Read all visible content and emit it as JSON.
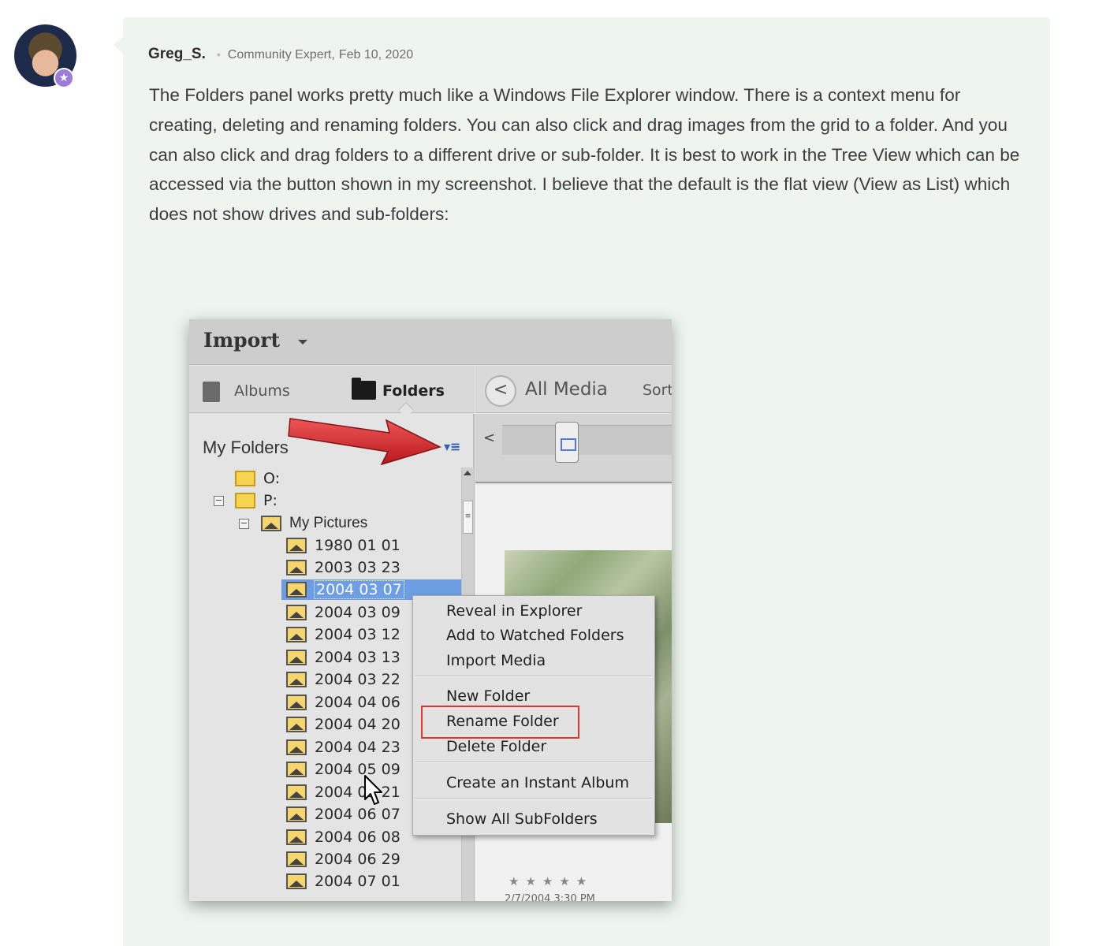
{
  "post": {
    "author": "Greg_S.",
    "separator": "•",
    "role": "Community Expert,",
    "date": "Feb 10, 2020",
    "body": "The Folders panel works pretty much like a Windows File Explorer window.  There is a context menu for creating, deleting and renaming folders.  You can also click and drag images from the grid to a folder.  And you can also click and drag folders to a different drive or sub-folder.  It is best to work in the Tree View which can be accessed via the button shown in my screenshot.  I believe that the default is the flat view (View as List) which does not show drives and sub-folders:"
  },
  "screenshot": {
    "title": "Import",
    "tabs": {
      "albums": "Albums",
      "folders": "Folders"
    },
    "panel_title": "My Folders",
    "view_toggle_glyph": "▾≡",
    "right_header": {
      "back": "<",
      "title": "All Media",
      "sort": "Sort"
    },
    "zoom_left": "<",
    "tree": {
      "drives": [
        "O:",
        "P:"
      ],
      "parent_folder": "My Pictures",
      "folders": [
        "1980 01 01",
        "2003 03 23",
        "2004 03 07",
        "2004 03 09",
        "2004 03 12",
        "2004 03 13",
        "2004 03 22",
        "2004 04 06",
        "2004 04 20",
        "2004 04 23",
        "2004 05 09",
        "2004 05 21",
        "2004 06 07",
        "2004 06 08",
        "2004 06 29",
        "2004 07 01"
      ],
      "selected_folder": "2004 03 07",
      "expander_minus": "−"
    },
    "context_menu": {
      "group1": [
        "Reveal in Explorer",
        "Add to Watched Folders",
        "Import Media"
      ],
      "group2": [
        "New Folder",
        "Rename Folder",
        "Delete Folder"
      ],
      "group3": [
        "Create an Instant Album"
      ],
      "group4": [
        "Show All SubFolders"
      ]
    },
    "stars": "★★★★★",
    "photo_date": "2/7/2004 3:30 PM"
  },
  "colors": {
    "post_background": "#edf5ee",
    "selection": "#6d9ee3",
    "highlight_box": "#e0372a",
    "annotation_arrow": "#d8191e",
    "folder_yellow": "#f6d451"
  }
}
